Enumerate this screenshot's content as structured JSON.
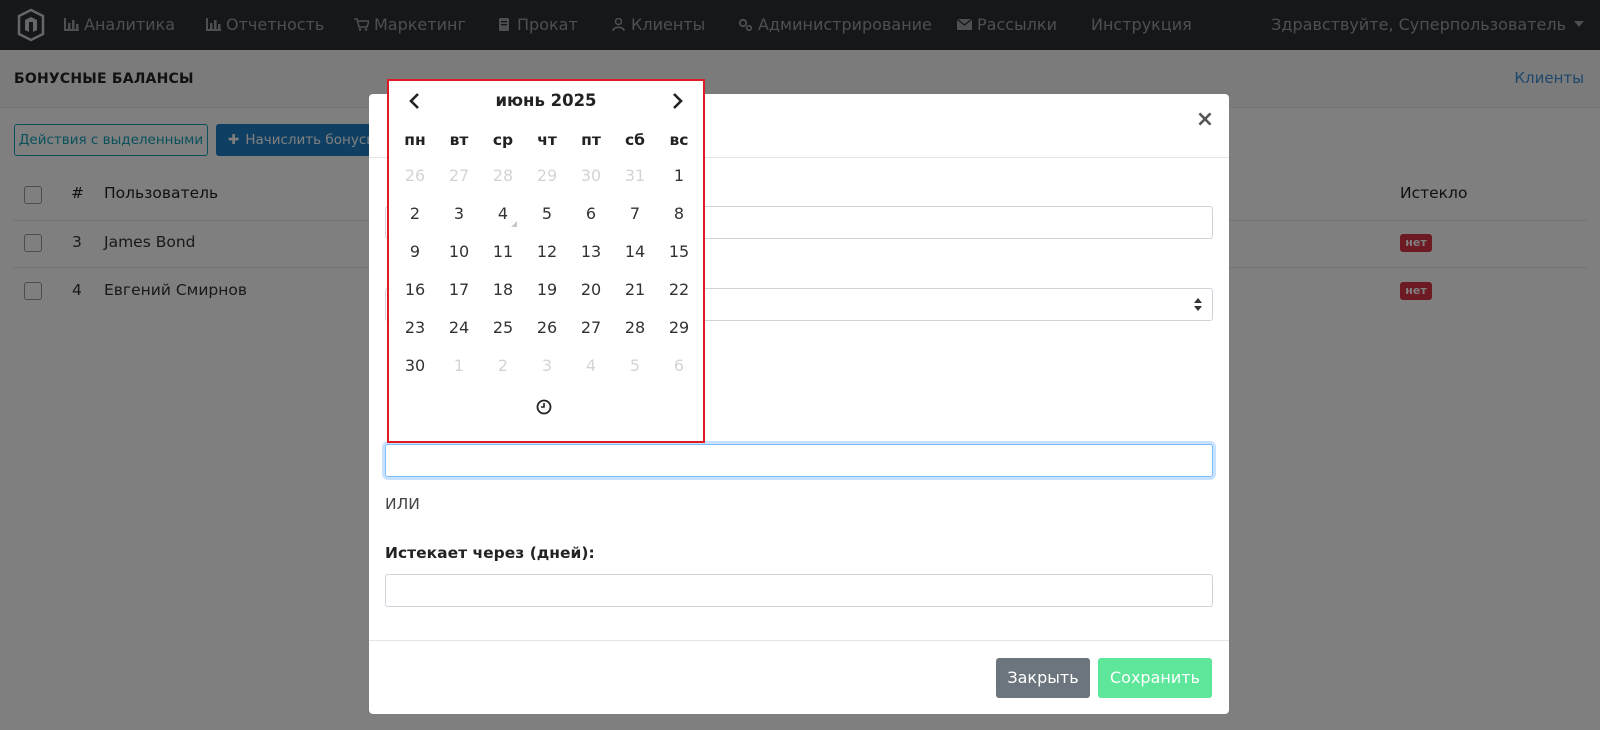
{
  "navbar": {
    "items": [
      {
        "label": "Аналитика",
        "icon": "bar-chart-icon"
      },
      {
        "label": "Отчетность",
        "icon": "bar-chart-icon"
      },
      {
        "label": "Маркетинг",
        "icon": "cart-icon"
      },
      {
        "label": "Прокат",
        "icon": "book-icon"
      },
      {
        "label": "Клиенты",
        "icon": "user-icon"
      },
      {
        "label": "Администрирование",
        "icon": "cogs-icon"
      },
      {
        "label": "Рассылки",
        "icon": "envelope-icon"
      },
      {
        "label": "Инструкция",
        "icon": ""
      }
    ],
    "user_greeting": "Здравствуйте, Суперпользователь"
  },
  "subheader": {
    "title": "БОНУСНЫЕ БАЛАНСЫ",
    "breadcrumb_link": "Клиенты"
  },
  "toolbar": {
    "bulk_actions_label": "Действия с выделенными",
    "add_bonus_label": "Начислить бонусы"
  },
  "table": {
    "headers": {
      "number": "#",
      "user": "Пользователь",
      "expired": "Истекло"
    },
    "rows": [
      {
        "id": "3",
        "user": "James Bond",
        "expired": "нет"
      },
      {
        "id": "4",
        "user": "Евгений Смирнов",
        "expired": "нет"
      }
    ]
  },
  "modal": {
    "close_symbol": "×",
    "or_text": "ИЛИ",
    "expires_in_label": "Истекает через (дней):",
    "close_button": "Закрыть",
    "save_button": "Сохранить"
  },
  "datepicker": {
    "title": "июнь 2025",
    "weekdays": [
      "пн",
      "вт",
      "ср",
      "чт",
      "пт",
      "сб",
      "вс"
    ],
    "weeks": [
      [
        "26",
        "27",
        "28",
        "29",
        "30",
        "31",
        "1"
      ],
      [
        "2",
        "3",
        "4",
        "5",
        "6",
        "7",
        "8"
      ],
      [
        "9",
        "10",
        "11",
        "12",
        "13",
        "14",
        "15"
      ],
      [
        "16",
        "17",
        "18",
        "19",
        "20",
        "21",
        "22"
      ],
      [
        "23",
        "24",
        "25",
        "26",
        "27",
        "28",
        "29"
      ],
      [
        "30",
        "1",
        "2",
        "3",
        "4",
        "5",
        "6"
      ]
    ],
    "today": "4",
    "colors": {
      "border": "#e01a22",
      "muted_day": "#d4d4d4"
    }
  },
  "colors": {
    "navbar_bg": "#2b3035",
    "info": "#17a2b8",
    "primary": "#1f7fc4",
    "danger": "#dc3545",
    "secondary": "#6c757d",
    "success_light": "#5ee69a"
  }
}
